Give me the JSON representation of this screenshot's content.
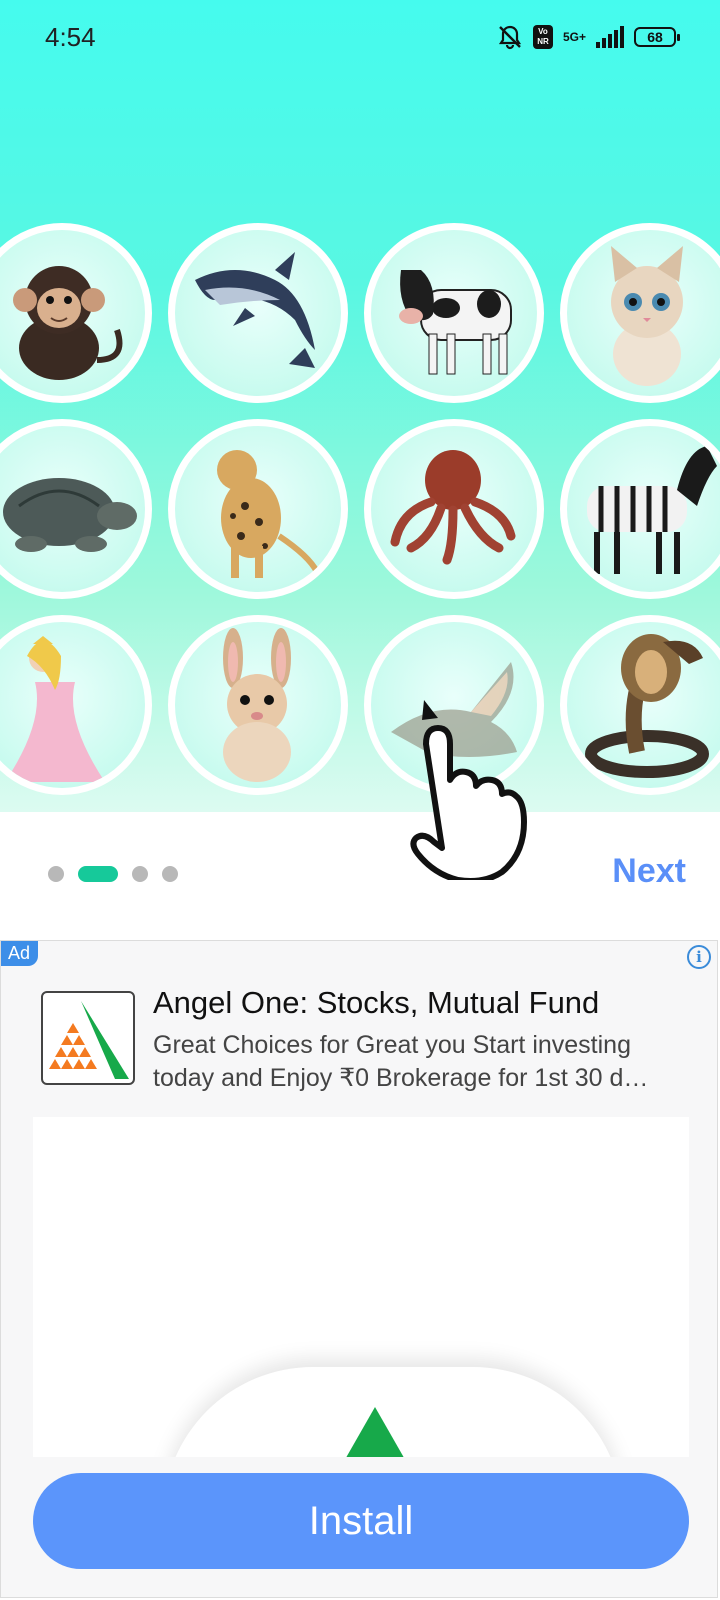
{
  "status_bar": {
    "time": "4:54",
    "network": "5G+",
    "volte": "Vo NR",
    "battery": "68",
    "icons": [
      "bell-off-icon",
      "volte-icon",
      "signal-icon",
      "battery-icon"
    ]
  },
  "animals": [
    {
      "name": "monkey",
      "icon": "monkey-icon"
    },
    {
      "name": "dolphin",
      "icon": "dolphin-icon"
    },
    {
      "name": "cow",
      "icon": "cow-icon"
    },
    {
      "name": "kitten",
      "icon": "kitten-icon"
    },
    {
      "name": "turtle",
      "icon": "turtle-icon"
    },
    {
      "name": "leopard",
      "icon": "leopard-icon"
    },
    {
      "name": "octopus",
      "icon": "octopus-icon"
    },
    {
      "name": "zebra",
      "icon": "zebra-icon"
    },
    {
      "name": "princess",
      "icon": "princess-icon"
    },
    {
      "name": "rabbit",
      "icon": "rabbit-icon"
    },
    {
      "name": "crocodile",
      "icon": "crocodile-icon"
    },
    {
      "name": "cobra",
      "icon": "cobra-icon"
    }
  ],
  "pager": {
    "count": 4,
    "active_index": 1
  },
  "next_label": "Next",
  "ad": {
    "badge": "Ad",
    "title": "Angel One: Stocks, Mutual Fund",
    "description_line1": "Great Choices for Great you Start investing",
    "description_line2": "today and Enjoy ₹0 Brokerage for 1st 30 d…",
    "install_label": "Install"
  },
  "colors": {
    "accent": "#5a8ff8",
    "pager_active": "#16c99a",
    "install": "#5b95fb",
    "ad_badge": "#3d8ee8",
    "logo_green": "#17a94a",
    "logo_orange": "#f47a20"
  }
}
